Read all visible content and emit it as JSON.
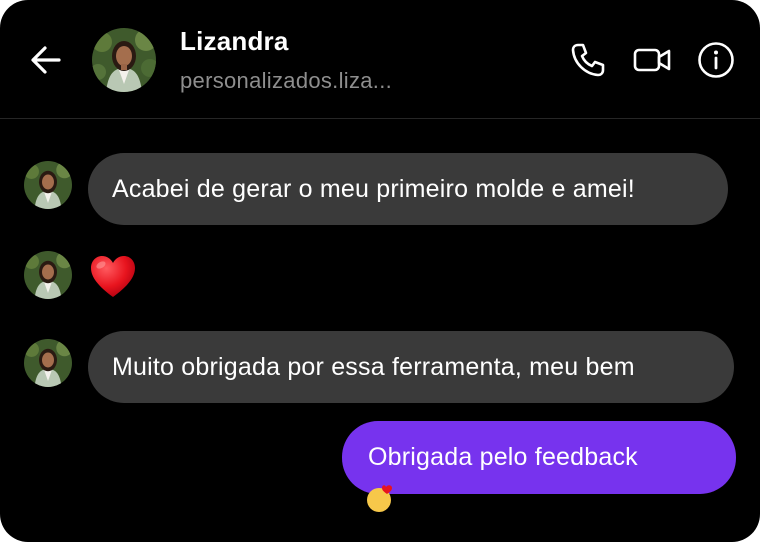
{
  "header": {
    "contact_name": "Lizandra",
    "contact_username": "personalizados.liza...",
    "icons": {
      "back": "arrow-left-icon",
      "call": "phone-icon",
      "video": "video-camera-icon",
      "info": "info-icon"
    }
  },
  "messages": [
    {
      "direction": "incoming",
      "type": "text",
      "text": "Acabei de gerar o meu primeiro molde e amei!"
    },
    {
      "direction": "incoming",
      "type": "emoji",
      "emoji": "heart-icon"
    },
    {
      "direction": "incoming",
      "type": "text",
      "text": "Muito obrigada por essa ferramenta, meu bem"
    },
    {
      "direction": "outgoing",
      "type": "text",
      "text": "Obrigada pelo feedback"
    }
  ],
  "colors": {
    "background": "#000000",
    "incoming_bubble": "#3a3a3a",
    "outgoing_bubble": "#7733ee",
    "text_primary": "#ffffff",
    "text_secondary": "#8e8e8e",
    "heart": "#e8141e"
  }
}
